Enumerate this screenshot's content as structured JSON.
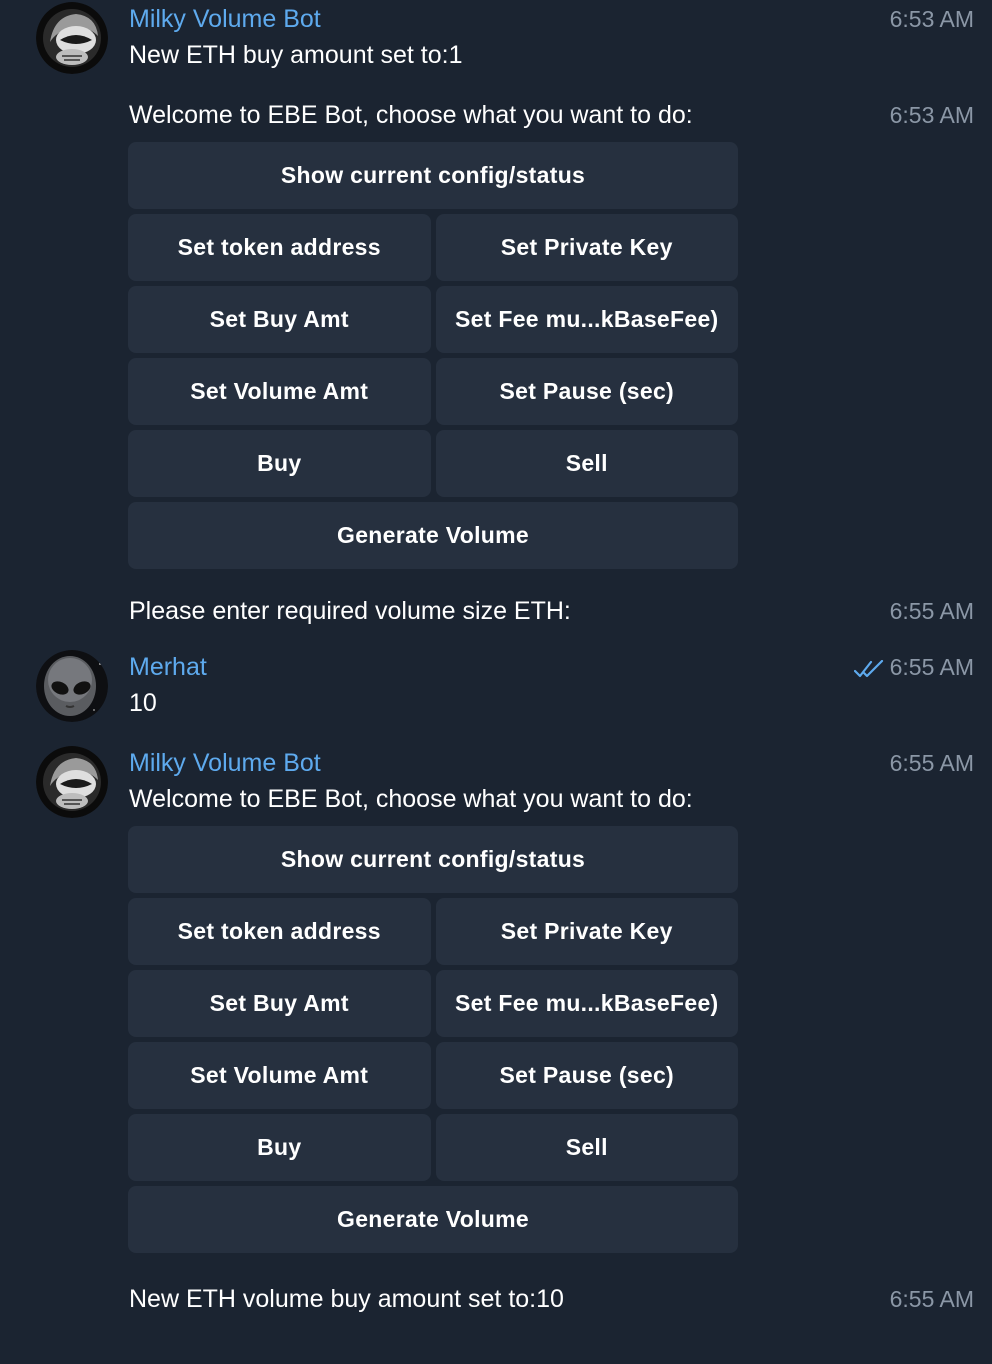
{
  "messages": {
    "m1": {
      "sender": "Milky Volume Bot",
      "text": "New ETH buy amount set to:1",
      "time": "6:53 AM"
    },
    "m2": {
      "text": "Welcome to EBE Bot, choose what you want to do:",
      "time": "6:53 AM"
    },
    "m3": {
      "text": "Please enter required volume size ETH:",
      "time": "6:55 AM"
    },
    "m4": {
      "sender": "Merhat",
      "text": "10",
      "time": "6:55 AM"
    },
    "m5": {
      "sender": "Milky Volume Bot",
      "text": "Welcome to EBE Bot, choose what you want to do:",
      "time": "6:55 AM"
    },
    "m6": {
      "text": "New ETH volume buy amount set to:10",
      "time": "6:55 AM"
    }
  },
  "keyboard": {
    "show_config": "Show current config/status",
    "set_token": "Set token address",
    "set_private_key": "Set Private Key",
    "set_buy_amt": "Set Buy Amt",
    "set_fee": "Set Fee mu...kBaseFee)",
    "set_volume_amt": "Set Volume Amt",
    "set_pause": "Set Pause (sec)",
    "buy": "Buy",
    "sell": "Sell",
    "generate_volume": "Generate Volume"
  },
  "icons": {
    "bot_avatar": "astronaut-helmet-icon",
    "user_avatar": "alien-face-icon",
    "read_receipt": "double-check-icon"
  },
  "colors": {
    "background": "#1b2431",
    "sender_name": "#5eaaee",
    "button": "#26303f",
    "timestamp": "#8b97a6"
  }
}
